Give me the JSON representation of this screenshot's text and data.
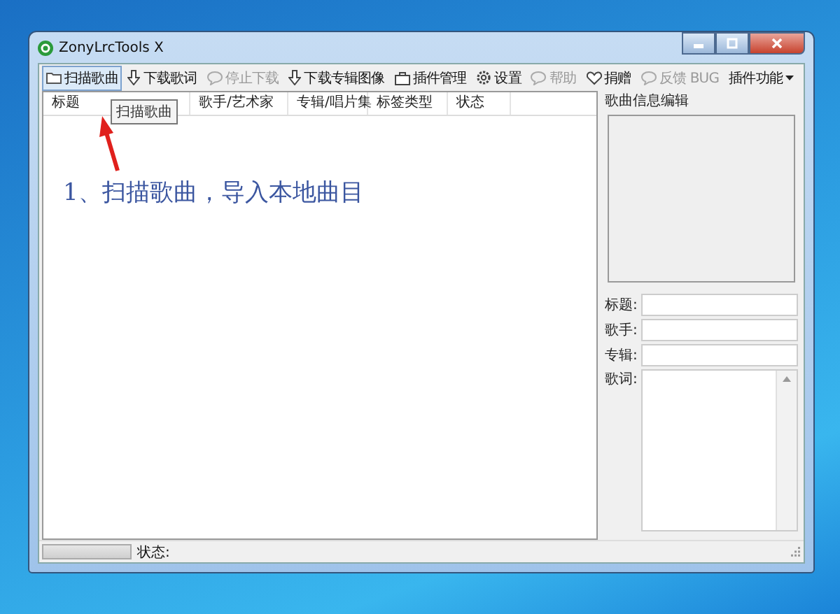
{
  "window": {
    "title": "ZonyLrcTools X"
  },
  "toolbar": [
    {
      "label": "扫描歌曲",
      "kind": "folder",
      "selected": true,
      "disabled": false
    },
    {
      "label": "下载歌词",
      "kind": "download",
      "selected": false,
      "disabled": false
    },
    {
      "label": "停止下载",
      "kind": "bubble",
      "selected": false,
      "disabled": true
    },
    {
      "label": "下载专辑图像",
      "kind": "download",
      "selected": false,
      "disabled": false
    },
    {
      "label": "插件管理",
      "kind": "toolbox",
      "selected": false,
      "disabled": false
    },
    {
      "label": "设置",
      "kind": "gear",
      "selected": false,
      "disabled": false
    },
    {
      "label": "帮助",
      "kind": "bubble",
      "selected": false,
      "disabled": true
    },
    {
      "label": "捐赠",
      "kind": "heart",
      "selected": false,
      "disabled": false
    },
    {
      "label": "反馈 BUG",
      "kind": "bubble",
      "selected": false,
      "disabled": true
    },
    {
      "label": "插件功能",
      "kind": "menu",
      "selected": false,
      "disabled": false
    }
  ],
  "tooltip": "扫描歌曲",
  "table": {
    "columns": [
      "标题",
      "歌手/艺术家",
      "专辑/唱片集",
      "标签类型",
      "状态"
    ]
  },
  "annotation": "1、扫描歌曲，导入本地曲目",
  "editor": {
    "title": "歌曲信息编辑",
    "fields": [
      {
        "label": "标题:"
      },
      {
        "label": "歌手:"
      },
      {
        "label": "专辑:"
      }
    ],
    "lyrics_label": "歌词:"
  },
  "status_bar": {
    "level": 0,
    "label": "状态:"
  }
}
